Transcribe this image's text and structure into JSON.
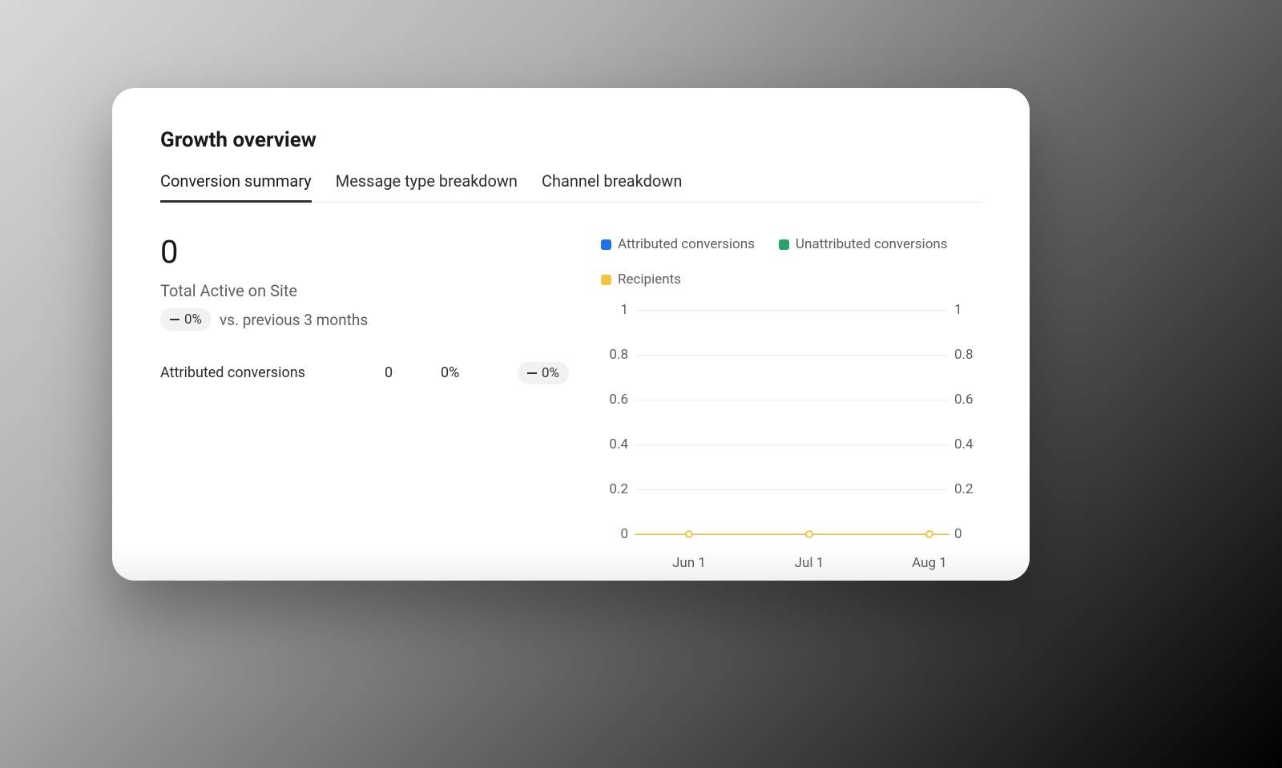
{
  "header": {
    "title": "Growth overview"
  },
  "tabs": [
    {
      "label": "Conversion summary",
      "active": true
    },
    {
      "label": "Message type breakdown",
      "active": false
    },
    {
      "label": "Channel breakdown",
      "active": false
    }
  ],
  "summary": {
    "big_value": "0",
    "metric_label": "Total Active on Site",
    "change_pill": "0%",
    "compare_text": "vs. previous 3 months"
  },
  "row": {
    "label": "Attributed conversions",
    "value1": "0",
    "value2": "0%",
    "change_pill": "0%"
  },
  "legend": {
    "attributed": "Attributed conversions",
    "unattributed": "Unattributed conversions",
    "recipients": "Recipients"
  },
  "colors": {
    "attributed": "#1f6feb",
    "unattributed": "#29a36a",
    "recipients": "#f6c343"
  },
  "y_ticks": [
    "1",
    "0.8",
    "0.6",
    "0.4",
    "0.2",
    "0"
  ],
  "x_ticks": [
    "Jun 1",
    "Jul 1",
    "Aug 1"
  ],
  "chart_data": {
    "type": "line",
    "title": "Growth overview — Conversion summary",
    "xlabel": "",
    "ylabel": "",
    "ylim": [
      0,
      1
    ],
    "y2lim": [
      0,
      1
    ],
    "categories": [
      "Jun 1",
      "Jul 1",
      "Aug 1"
    ],
    "series": [
      {
        "name": "Attributed conversions",
        "values": [
          0,
          0,
          0
        ]
      },
      {
        "name": "Unattributed conversions",
        "values": [
          0,
          0,
          0
        ]
      },
      {
        "name": "Recipients",
        "values": [
          0,
          0,
          0
        ]
      }
    ]
  }
}
